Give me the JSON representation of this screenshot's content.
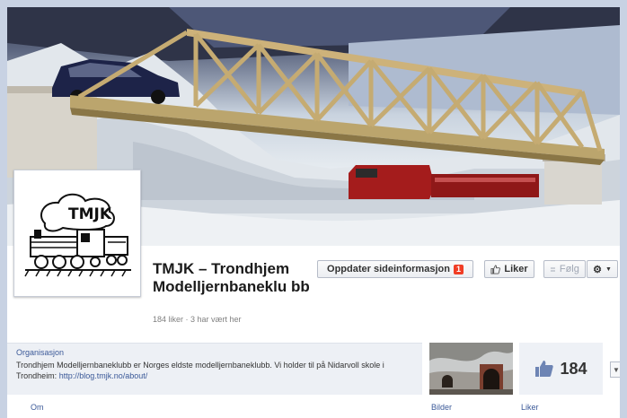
{
  "page": {
    "name": "TMJK – Trondhjem Modelljernbaneklu bb",
    "meta": "184 liker · 3 har vært her",
    "logo_text": "TMJK"
  },
  "actions": {
    "update_label": "Oppdater sideinformasjon",
    "update_badge": "1",
    "like_label": "Liker",
    "follow_label": "Følg",
    "gear_icon": "gear-icon"
  },
  "about": {
    "category": "Organisasjon",
    "description": "Trondhjem Modelljernbaneklubb er Norges eldste modelljernbaneklubb. Vi holder til på Nidarvoll skole i Trondheim: ",
    "link": "http://blog.tmjk.no/about/"
  },
  "stats": {
    "likes_count": "184"
  },
  "tabs": {
    "om": "Om",
    "bilder": "Bilder",
    "liker": "Liker"
  },
  "colors": {
    "link": "#3b5998",
    "badge": "#f03d25"
  }
}
